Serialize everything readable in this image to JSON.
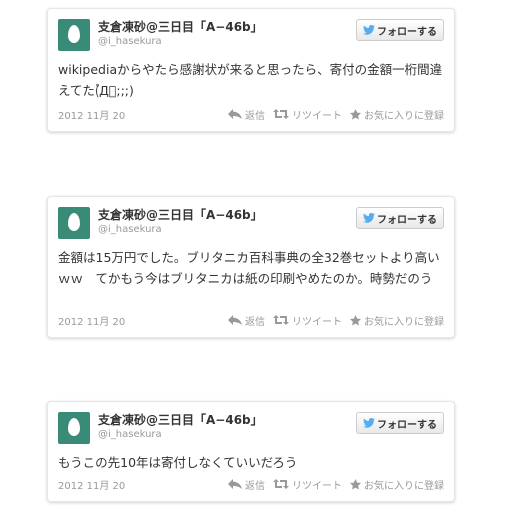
{
  "colors": {
    "avatar_bg": "#3a8a78",
    "twitter_blue": "#55acee",
    "muted": "#999999",
    "text": "#333333"
  },
  "tweets": [
    {
      "display_name": "支倉凍砂@三日目「A−46b」",
      "handle": "@i_hasekura",
      "follow_label": "フォローする",
      "text": "wikipediaからやたら感謝状が来ると思ったら、寄付の金額一桁間違えてた(゚Д゚;;;)",
      "date": "2012 11月 20",
      "reply_label": "返信",
      "retweet_label": "リツイート",
      "favorite_label": "お気に入りに登録"
    },
    {
      "display_name": "支倉凍砂@三日目「A−46b」",
      "handle": "@i_hasekura",
      "follow_label": "フォローする",
      "text": "金額は15万円でした。ブリタニカ百科事典の全32巻セットより高いｗｗ　てかもう今はブリタニカは紙の印刷やめたのか。時勢だのう",
      "date": "2012 11月 20",
      "reply_label": "返信",
      "retweet_label": "リツイート",
      "favorite_label": "お気に入りに登録"
    },
    {
      "display_name": "支倉凍砂@三日目「A−46b」",
      "handle": "@i_hasekura",
      "follow_label": "フォローする",
      "text": "もうこの先10年は寄付しなくていいだろう",
      "date": "2012 11月 20",
      "reply_label": "返信",
      "retweet_label": "リツイート",
      "favorite_label": "お気に入りに登録"
    }
  ],
  "icons": {
    "avatar": "egg-avatar-icon",
    "follow": "twitter-bird-icon",
    "reply": "reply-arrow-icon",
    "retweet": "retweet-icon",
    "favorite": "star-icon"
  }
}
